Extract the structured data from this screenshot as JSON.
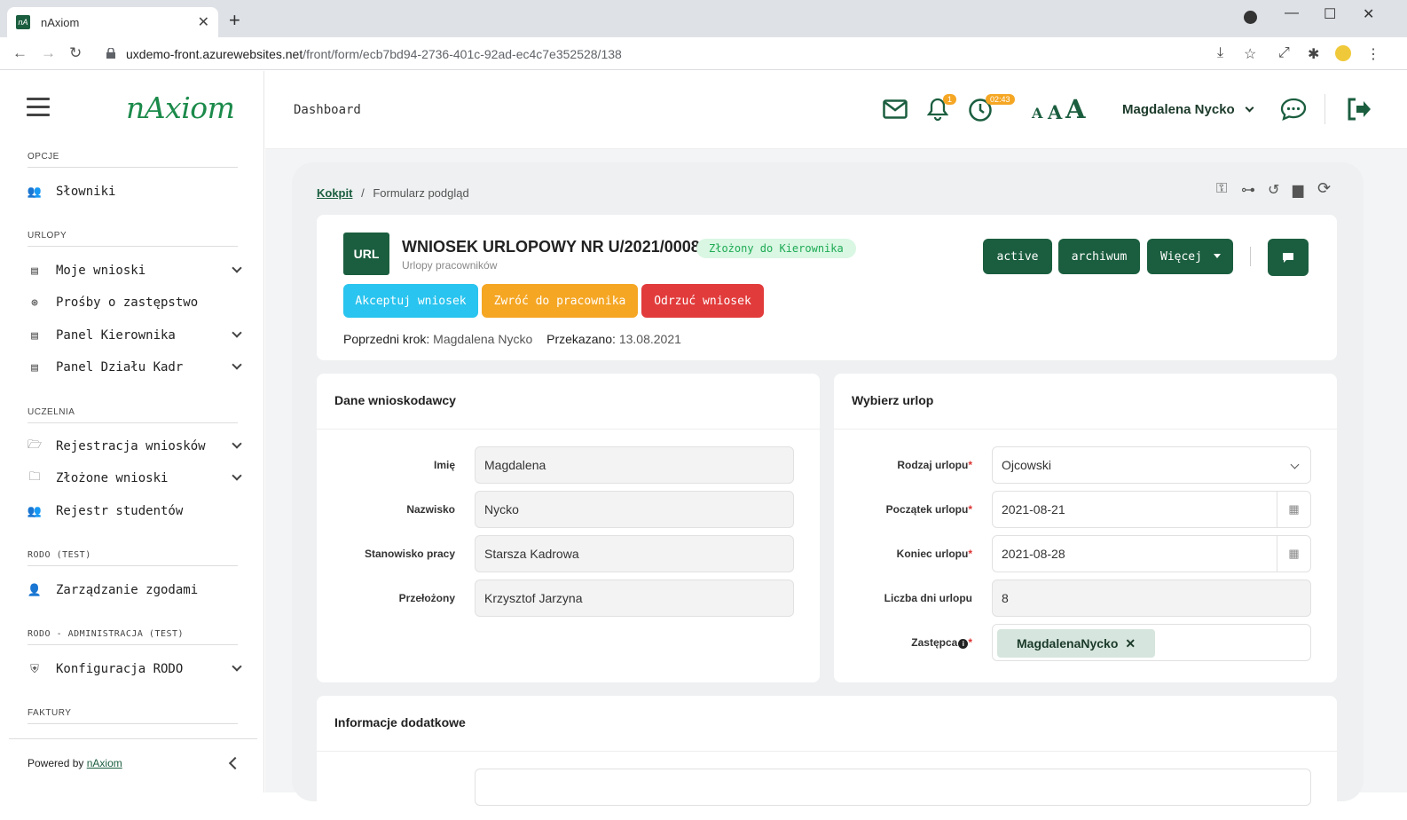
{
  "browser": {
    "tab_title": "nAxiom",
    "url_host": "uxdemo-front.azurewebsites.net",
    "url_path": "/front/form/ecb7bd94-2736-401c-92ad-ec4c7e352528/138"
  },
  "sidebar": {
    "logo": "nAxiom",
    "sections": {
      "opcje": "OPCJE",
      "urlopy": "URLOPY",
      "uczelnia": "UCZELNIA",
      "rodo": "RODO (TEST)",
      "rodo_admin": "RODO - ADMINISTRACJA (TEST)",
      "faktury": "FAKTURY"
    },
    "items": {
      "slowniki": "Słowniki",
      "moje_wnioski": "Moje wnioski",
      "prosby": "Prośby o zastępstwo",
      "panel_kierownika": "Panel Kierownika",
      "panel_kadr": "Panel Działu Kadr",
      "rejestracja": "Rejestracja wniosków",
      "zlozone": "Złożone wnioski",
      "rejestr": "Rejestr studentów",
      "zgody": "Zarządzanie zgodami",
      "konfiguracja": "Konfiguracja RODO"
    },
    "powered_by": "Powered by",
    "powered_link": "nAxiom"
  },
  "header": {
    "dashboard": "Dashboard",
    "notif_count": "1",
    "timer": "02:43",
    "user": "Magdalena Nycko"
  },
  "breadcrumb": {
    "home": "Kokpit",
    "sep": "/",
    "current": "Formularz podgląd"
  },
  "form": {
    "badge": "URL",
    "title": "WNIOSEK URLOPOWY NR U/2021/00087",
    "status": "Złożony do Kierownika",
    "subtitle": "Urlopy pracowników",
    "accept": "Akceptuj wniosek",
    "return": "Zwróć do pracownika",
    "reject": "Odrzuć wniosek",
    "active": "active",
    "archive": "archiwum",
    "more": "Więcej",
    "prev_label": "Poprzedni krok:",
    "prev_value": "Magdalena Nycko",
    "passed_label": "Przekazano:",
    "passed_value": "13.08.2021"
  },
  "applicant": {
    "title": "Dane wnioskodawcy",
    "first_name_label": "Imię",
    "first_name": "Magdalena",
    "last_name_label": "Nazwisko",
    "last_name": "Nycko",
    "position_label": "Stanowisko pracy",
    "position": "Starsza Kadrowa",
    "supervisor_label": "Przełożony",
    "supervisor": "Krzysztof Jarzyna"
  },
  "leave": {
    "title": "Wybierz urlop",
    "type_label": "Rodzaj urlopu",
    "type": "Ojcowski",
    "start_label": "Początek urlopu",
    "start": "2021-08-21",
    "end_label": "Koniec urlopu",
    "end": "2021-08-28",
    "days_label": "Liczba dni urlopu",
    "days": "8",
    "substitute_label": "Zastępca",
    "substitute": "MagdalenaNycko"
  },
  "extra": {
    "title": "Informacje dodatkowe"
  },
  "colors": {
    "primary": "#1b5e3f",
    "accept": "#29c4ef",
    "return": "#f5a623",
    "reject": "#e23b3b"
  }
}
